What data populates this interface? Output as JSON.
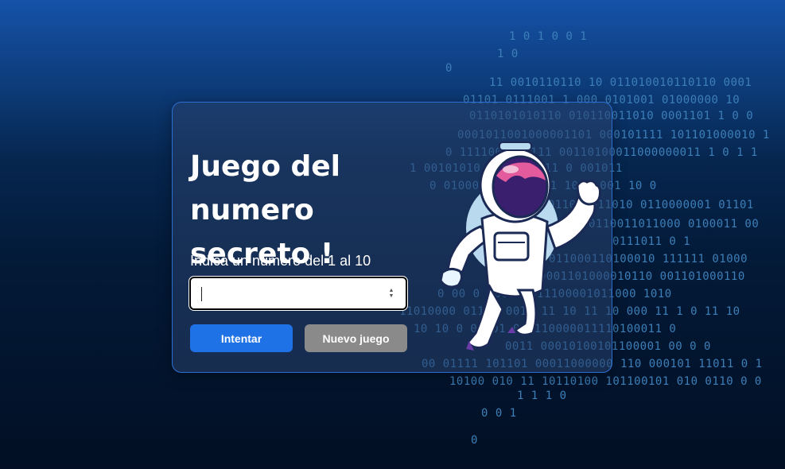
{
  "game": {
    "title_line1": "Juego del",
    "title_line2": "numero secreto !",
    "prompt": "Indica un numero del 1 al 10",
    "input_value": "",
    "input_placeholder": ""
  },
  "buttons": {
    "try_label": "Intentar",
    "new_game_label": "Nuevo juego"
  },
  "colors": {
    "primary_button": "#1e72e6",
    "secondary_button": "#8a8a8a",
    "card_border": "#2d6fd1"
  },
  "icons": {
    "illustration": "astronaut-icon",
    "background": "binary-code-pattern"
  }
}
